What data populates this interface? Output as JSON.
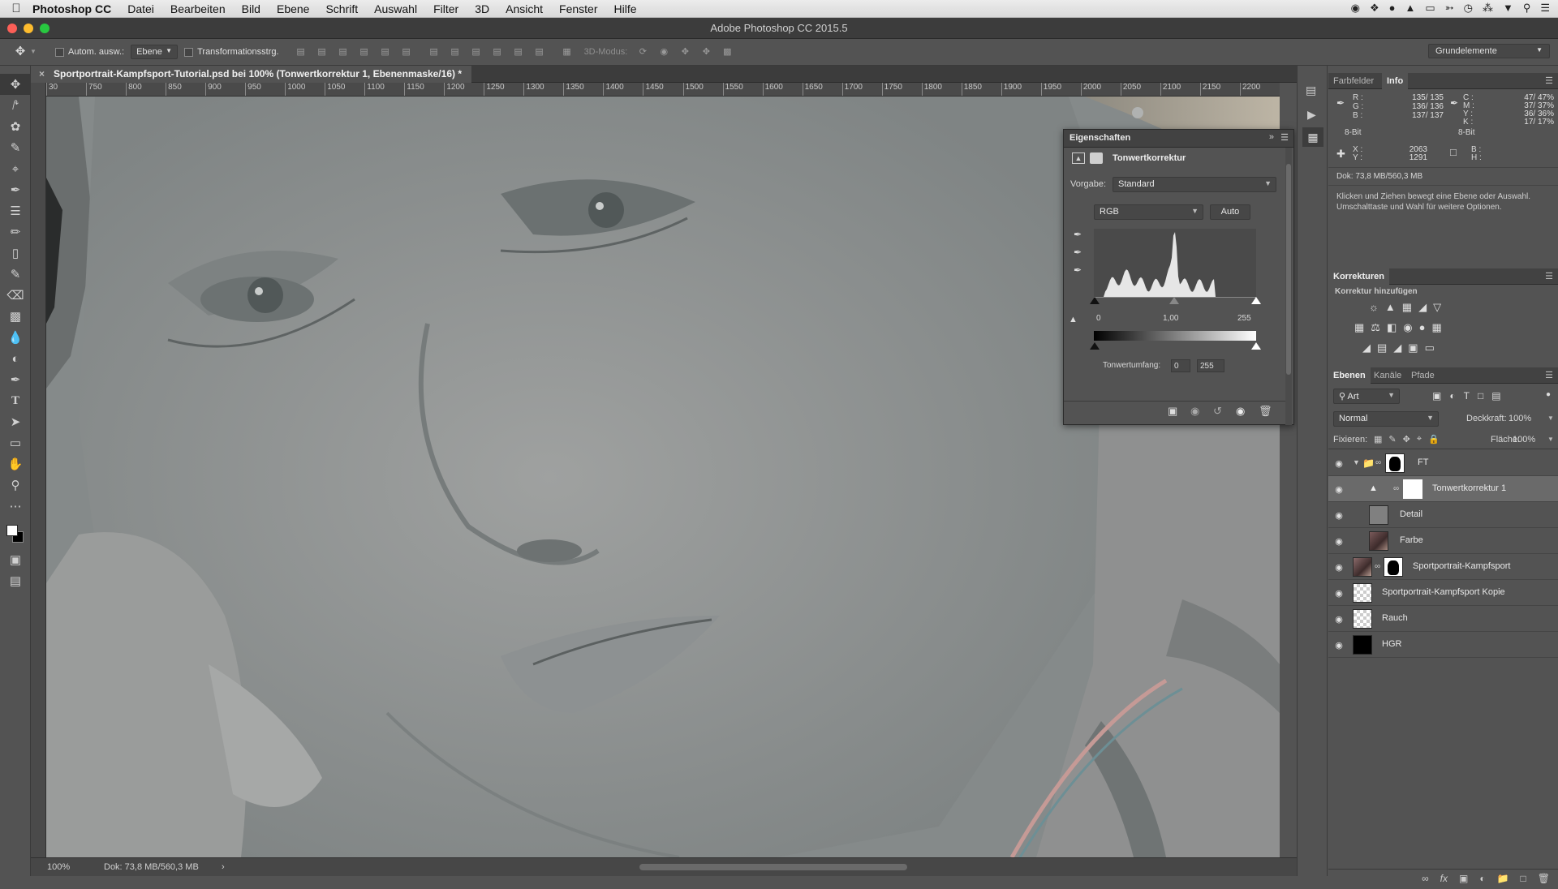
{
  "menubar": {
    "app": "Photoshop CC",
    "items": [
      "Datei",
      "Bearbeiten",
      "Bild",
      "Ebene",
      "Schrift",
      "Auswahl",
      "Filter",
      "3D",
      "Ansicht",
      "Fenster",
      "Hilfe"
    ]
  },
  "window": {
    "title": "Adobe Photoshop CC 2015.5"
  },
  "options": {
    "auto_select_label": "Autom. ausw.:",
    "auto_select_value": "Ebene",
    "transform_label": "Transformationsstrg.",
    "mode3d_label": "3D-Modus:",
    "workspace": "Grundelemente"
  },
  "document": {
    "tab_title": "Sportportrait-Kampfsport-Tutorial.psd bei 100% (Tonwertkorrektur 1, Ebenenmaske/16) *",
    "zoom": "100%",
    "doc_size": "Dok: 73,8 MB/560,3 MB"
  },
  "ruler": {
    "h_ticks": [
      "30",
      "750",
      "800",
      "850",
      "900",
      "950",
      "1000",
      "1050",
      "1100",
      "1150",
      "1200",
      "1250",
      "1300",
      "1350",
      "1400",
      "1450",
      "1500",
      "1550",
      "1600",
      "1650",
      "1700",
      "1750",
      "1800",
      "1850",
      "1900",
      "1950",
      "2000",
      "2050",
      "2100",
      "2150",
      "2200"
    ]
  },
  "properties": {
    "panel_title": "Eigenschaften",
    "adjustment_name": "Tonwertkorrektur",
    "preset_label": "Vorgabe:",
    "preset_value": "Standard",
    "channel": "RGB",
    "auto_label": "Auto",
    "input_black": "0",
    "input_gamma": "1,00",
    "input_white": "255",
    "output_label": "Tonwertumfang:",
    "output_black": "0",
    "output_white": "255"
  },
  "info_panel": {
    "tabs": [
      "Farbfelder",
      "Info"
    ],
    "rgb_labels": [
      "R :",
      "G :",
      "B :"
    ],
    "rgb_values": [
      "135/ 135",
      "136/ 136",
      "137/ 137"
    ],
    "cmyk_labels": [
      "C :",
      "M :",
      "Y :",
      "K :"
    ],
    "cmyk_values": [
      "47/ 47%",
      "37/ 37%",
      "36/ 36%",
      "17/ 17%"
    ],
    "bit_left": "8-Bit",
    "bit_right": "8-Bit",
    "xy_labels": [
      "X :",
      "Y :"
    ],
    "xy_values": [
      "2063",
      "1291"
    ],
    "wh_labels": [
      "B :",
      "H :"
    ],
    "doc": "Dok: 73,8 MB/560,3 MB",
    "hint": "Klicken und Ziehen bewegt eine Ebene oder Auswahl. Umschalttaste und Wahl für weitere Optionen."
  },
  "corrections": {
    "title": "Korrekturen",
    "subtitle": "Korrektur hinzufügen"
  },
  "layers_panel": {
    "tabs": [
      "Ebenen",
      "Kanäle",
      "Pfade"
    ],
    "filter_label": "Art",
    "blend_mode": "Normal",
    "opacity_label": "Deckkraft:",
    "opacity_value": "100%",
    "lock_label": "Fixieren:",
    "fill_label": "Fläche:",
    "fill_value": "100%",
    "layers": [
      {
        "name": "FT"
      },
      {
        "name": "Tonwertkorrektur 1"
      },
      {
        "name": "Detail"
      },
      {
        "name": "Farbe"
      },
      {
        "name": "Sportportrait-Kampfsport"
      },
      {
        "name": "Sportportrait-Kampfsport Kopie"
      },
      {
        "name": "Rauch"
      },
      {
        "name": "HGR"
      }
    ]
  }
}
